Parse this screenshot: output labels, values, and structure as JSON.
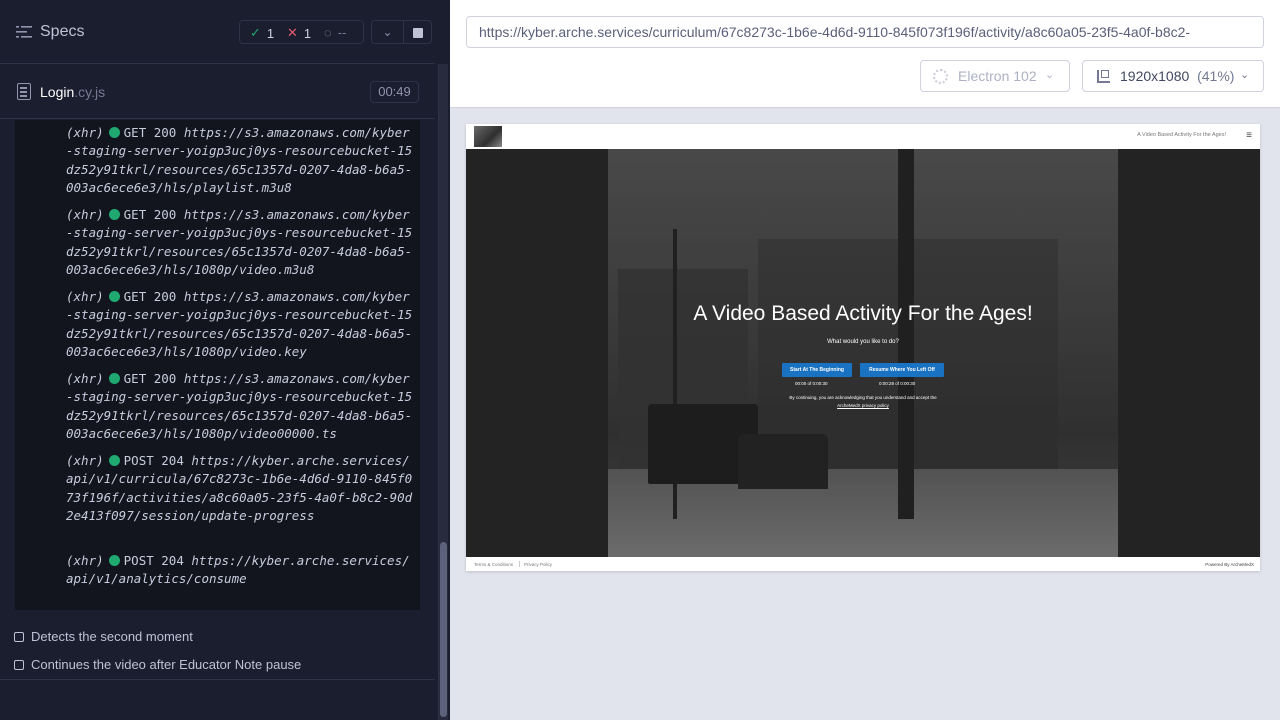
{
  "reporter": {
    "title": "Specs",
    "stats": {
      "passed": "1",
      "failed": "1",
      "pending": "--"
    },
    "spec_file": {
      "name": "Login",
      "ext": ".cy.js",
      "duration": "00:49"
    },
    "logs": [
      {
        "type": "(xhr)",
        "method": "GET",
        "status": "200",
        "url": "https://s3.amazonaws.com/kyber-staging-server-yoigp3ucj0ys-resourcebucket-15dz52y91tkrl/resources/65c1357d-0207-4da8-b6a5-003ac6ece6e3/hls/playlist.m3u8"
      },
      {
        "type": "(xhr)",
        "method": "GET",
        "status": "200",
        "url": "https://s3.amazonaws.com/kyber-staging-server-yoigp3ucj0ys-resourcebucket-15dz52y91tkrl/resources/65c1357d-0207-4da8-b6a5-003ac6ece6e3/hls/1080p/video.m3u8"
      },
      {
        "type": "(xhr)",
        "method": "GET",
        "status": "200",
        "url": "https://s3.amazonaws.com/kyber-staging-server-yoigp3ucj0ys-resourcebucket-15dz52y91tkrl/resources/65c1357d-0207-4da8-b6a5-003ac6ece6e3/hls/1080p/video.key"
      },
      {
        "type": "(xhr)",
        "method": "GET",
        "status": "200",
        "url": "https://s3.amazonaws.com/kyber-staging-server-yoigp3ucj0ys-resourcebucket-15dz52y91tkrl/resources/65c1357d-0207-4da8-b6a5-003ac6ece6e3/hls/1080p/video00000.ts"
      },
      {
        "type": "(xhr)",
        "method": "POST",
        "status": "204",
        "url": "https://kyber.arche.services/api/v1/curricula/67c8273c-1b6e-4d6d-9110-845f073f196f/activities/a8c60a05-23f5-4a0f-b8c2-90d2e413f097/session/update-progress"
      },
      {
        "type": "(xhr)",
        "method": "POST",
        "status": "204",
        "url": "https://kyber.arche.services/api/v1/analytics/consume"
      }
    ],
    "tests": [
      {
        "label": "Detects the second moment"
      },
      {
        "label": "Continues the video after Educator Note pause"
      }
    ]
  },
  "aut": {
    "url": "https://kyber.arche.services/curriculum/67c8273c-1b6e-4d6d-9110-845f073f196f/activity/a8c60a05-23f5-4a0f-b8c2-",
    "browser": "Electron 102",
    "viewport": "1920x1080",
    "viewport_pct": "(41%)"
  },
  "app": {
    "top_title": "A Video Based Activity For the Ages!",
    "hero_title": "A Video Based Activity For the Ages!",
    "hero_subtitle": "What would you like to do?",
    "btn_begin": "Start At The Beginning",
    "btn_resume": "Resume Where You Left Off",
    "time_begin": "00:00    of    0:00:30",
    "time_resume": "0:00:28    of    0:00:30",
    "consent_text": "By continuing, you are acknowledging that you understand and accept the",
    "consent_link": "ArcheMedX privacy policy",
    "footer_terms": "Terms & Conditions",
    "footer_privacy": "Privacy Policy",
    "footer_powered": "Powered By ArcheMedX"
  },
  "colors": {
    "pass": "#1fa971",
    "fail": "#e45770",
    "accent": "#1a72c2"
  }
}
